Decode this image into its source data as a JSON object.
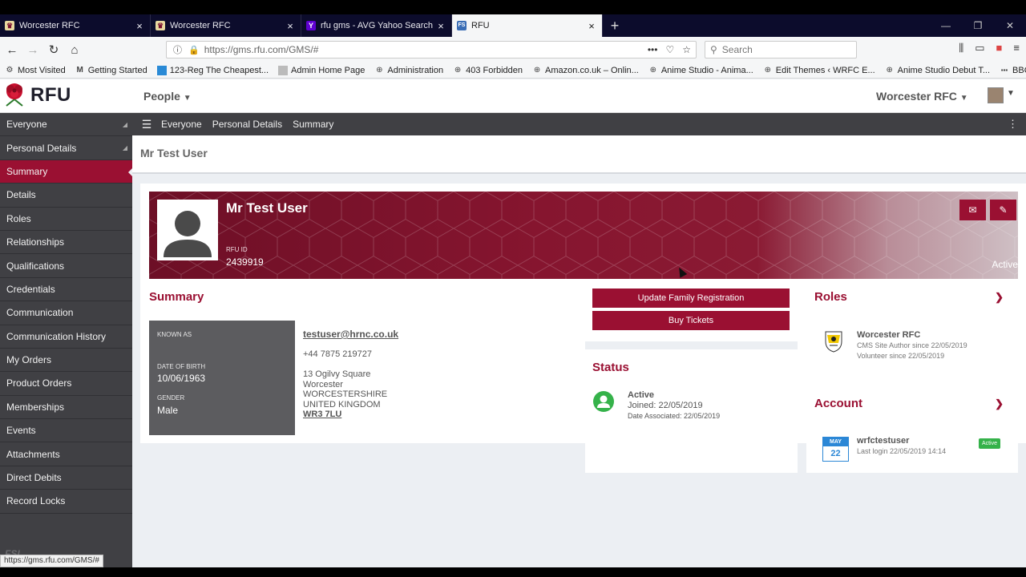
{
  "browser": {
    "tabs": [
      {
        "title": "Worcester RFC",
        "active": false
      },
      {
        "title": "Worcester RFC",
        "active": false
      },
      {
        "title": "rfu gms - AVG Yahoo Search Re",
        "active": false
      },
      {
        "title": "RFU",
        "active": true
      }
    ],
    "url": "https://gms.rfu.com/GMS/#",
    "search_placeholder": "Search",
    "bookmarks": [
      "Most Visited",
      "Getting Started",
      "123-Reg The Cheapest...",
      "Admin Home Page",
      "Administration",
      "403 Forbidden",
      "Amazon.co.uk – Onlin...",
      "Anime Studio - Anima...",
      "Edit Themes ‹ WRFC E...",
      "Anime Studio Debut T...",
      "BBC News - Home"
    ],
    "status_url": "https://gms.rfu.com/GMS/#"
  },
  "header": {
    "logo_text": "RFU",
    "menu_label": "People",
    "club_label": "Worcester RFC"
  },
  "sidebar": {
    "items": [
      {
        "label": "Everyone"
      },
      {
        "label": "Personal Details"
      },
      {
        "label": "Summary"
      },
      {
        "label": "Details"
      },
      {
        "label": "Roles"
      },
      {
        "label": "Relationships"
      },
      {
        "label": "Qualifications"
      },
      {
        "label": "Credentials"
      },
      {
        "label": "Communication"
      },
      {
        "label": "Communication History"
      },
      {
        "label": "My Orders"
      },
      {
        "label": "Product Orders"
      },
      {
        "label": "Memberships"
      },
      {
        "label": "Events"
      },
      {
        "label": "Attachments"
      },
      {
        "label": "Direct Debits"
      },
      {
        "label": "Record Locks"
      }
    ],
    "footer_text": "FSI"
  },
  "breadcrumb": [
    "Everyone",
    "Personal Details",
    "Summary"
  ],
  "page_title": "Mr Test User",
  "hero": {
    "name": "Mr Test User",
    "id_label": "RFU ID",
    "id_value": "2439919",
    "status": "Active"
  },
  "summary": {
    "title": "Summary",
    "known_as_label": "KNOWN AS",
    "dob_label": "DATE OF BIRTH",
    "dob_value": "10/06/1963",
    "gender_label": "GENDER",
    "gender_value": "Male",
    "email": "testuser@hrnc.co.uk",
    "phone": "+44 7875 219727",
    "address": [
      "13 Ogilvy Square",
      "Worcester",
      "WORCESTERSHIRE",
      "UNITED KINGDOM"
    ],
    "postcode": "WR3 7LU"
  },
  "actions": {
    "update_family": "Update Family Registration",
    "buy_tickets": "Buy Tickets"
  },
  "status": {
    "title": "Status",
    "state": "Active",
    "joined": "Joined: 22/05/2019",
    "date_associated": "Date Associated: 22/05/2019"
  },
  "roles": {
    "title": "Roles",
    "org": "Worcester RFC",
    "lines": [
      "CMS Site Author  since 22/05/2019",
      "Volunteer  since 22/05/2019"
    ]
  },
  "account": {
    "title": "Account",
    "cal_month": "MAY",
    "cal_day": "22",
    "username": "wrfctestuser",
    "last_login": "Last login 22/05/2019 14:14",
    "badge": "Active"
  },
  "colors": {
    "brand": "#9a1032",
    "sidebar": "#404044",
    "status_green": "#35b24a",
    "calendar_blue": "#2b87d6"
  }
}
